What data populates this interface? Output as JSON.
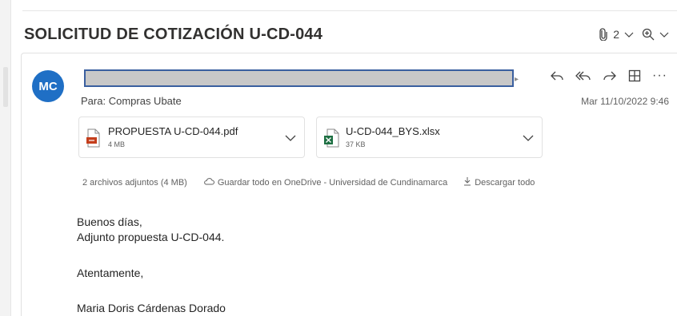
{
  "email": {
    "subject": "SOLICITUD DE COTIZACIÓN U-CD-044",
    "attachment_count": "2",
    "sender_initials": "MC",
    "to_label": "Para:",
    "to_value": "Compras Ubate",
    "date": "Mar 11/10/2022 9:46"
  },
  "attachments": [
    {
      "name": "PROPUESTA U-CD-044.pdf",
      "size": "4 MB",
      "icon": "pdf-file-icon",
      "color": "#c43e1c"
    },
    {
      "name": "U-CD-044_BYS.xlsx",
      "size": "37 KB",
      "icon": "excel-file-icon",
      "color": "#1d6f42"
    }
  ],
  "attachment_summary": {
    "count_text": "2 archivos adjuntos (4 MB)",
    "save_all": "Guardar todo en OneDrive - Universidad de Cundinamarca",
    "download_all": "Descargar todo"
  },
  "body": {
    "greeting": "Buenos días,",
    "line1": "Adjunto propuesta U-CD-044.",
    "closing": "Atentamente,",
    "signature": "Maria Doris Cárdenas Dorado"
  },
  "colors": {
    "avatar": "#1f6fc5",
    "redaction": "#c8c8c8",
    "redaction_border": "#3a5f9f"
  }
}
